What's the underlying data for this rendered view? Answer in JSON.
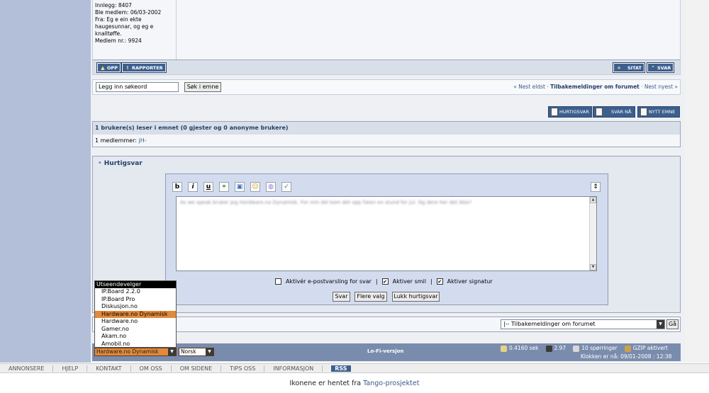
{
  "post": {
    "info_lines": [
      "Innlegg: 8407",
      "Ble medlem: 06/03-2002",
      "Fra: Eg e ein ekte",
      "haugesunnar, og eg e",
      "knalltøffe.",
      "Medlem nr.: 9924"
    ],
    "buttons": {
      "up": "OPP",
      "report": "RAPPORTER",
      "quote": "SITAT",
      "reply": "SVAR"
    }
  },
  "search": {
    "placeholder": "Legg inn søkeord",
    "button": "Søk i emne"
  },
  "topicnav": {
    "prev": "« Nest eldst",
    "sep1": " · ",
    "forum": "Tilbakemeldinger om forumet",
    "sep2": " · ",
    "next": "Nest nyest »"
  },
  "actions": {
    "quickreply": "HURTIGSVAR",
    "replynow": "SVAR NÅ",
    "newtopic": "NYTT EMNE"
  },
  "readers": {
    "header": "1 brukere(s) leser i emnet (0 gjester og 0 anonyme brukere)",
    "members_label": "1 medlemmer:",
    "member": "jH-"
  },
  "quickreply": {
    "title": "Hurtigsvar",
    "toolbar": {
      "bold": "b",
      "italic": "i",
      "underline": "u"
    },
    "text": "As we speak bruker jeg Hardware.no Dynamisk. For min del kom det opp faten en stund for jul. Og dere her det ikke?",
    "options": {
      "email": "Aktivér e-postvarsling for svar",
      "smilies": "Aktiver smil",
      "signature": "Aktiver signatur",
      "sep": "|"
    },
    "buttons": {
      "reply": "Svar",
      "more": "Flere valg",
      "close": "Lukk hurtigsvar"
    }
  },
  "jump": {
    "selected": "|-- Tilbakemeldinger om forumet",
    "go": "Gå"
  },
  "footer": {
    "skin_selected": "Hardware.no Dynamisk",
    "language": "Norsk",
    "lofi": "Lo-Fi-versjon",
    "stats": {
      "time": "0.4160 sek",
      "load": "2.97",
      "queries": "10 spørringer",
      "gzip": "GZIP aktivert"
    },
    "clock": "Klokken er nå: 09/01-2008 : 12:38"
  },
  "skin_dropdown": {
    "header": "Utseendevelger",
    "items": [
      "IP.Board 2.2.0",
      "IP.Board Pro",
      "Diskusjon.no",
      "Hardware.no Dynamisk",
      "Hardware.no",
      "Gamer.no",
      "Akam.no",
      "Amobil.no"
    ],
    "selected_index": 3
  },
  "bottom_menu": {
    "items": [
      "ANNONSERE",
      "HJELP",
      "KONTAKT",
      "OM OSS",
      "OM SIDENE",
      "TIPS OSS",
      "INFORMASJON"
    ],
    "rss": "RSS"
  },
  "credits": {
    "prefix": "Ikonene er hentet fra",
    "link": "Tango-prosjektet"
  },
  "colors": {
    "accent": "#3d5f8e",
    "selected": "#e28a3b",
    "footer_bar": "#7a8cad"
  }
}
